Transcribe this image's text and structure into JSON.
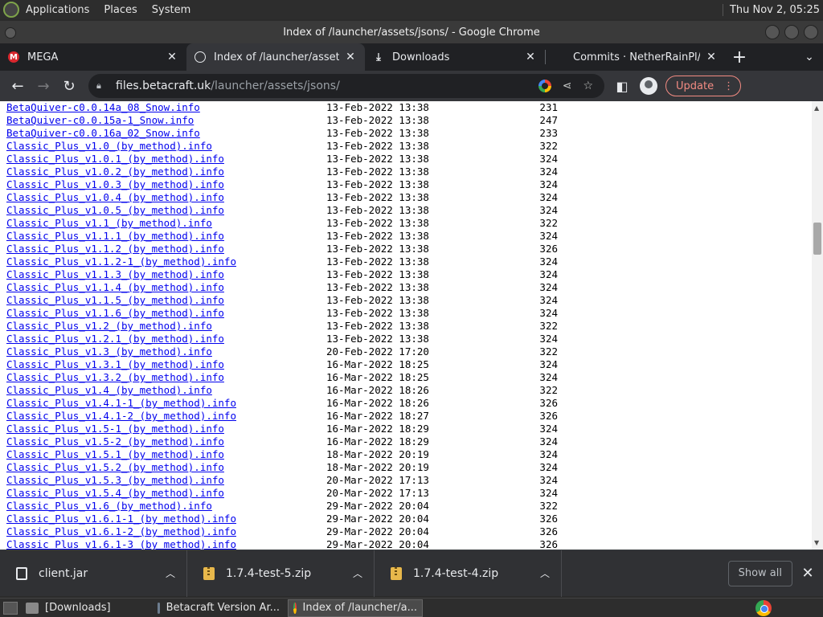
{
  "top_panel": {
    "menus": [
      "Applications",
      "Places",
      "System"
    ],
    "clock": "Thu Nov 2, 05:25"
  },
  "window": {
    "title": "Index of /launcher/assets/jsons/ - Google Chrome"
  },
  "tabs": [
    {
      "title": "MEGA",
      "favicon": "mega-icon",
      "active": false
    },
    {
      "title": "Index of /launcher/assets/jsons/",
      "favicon": "globe-icon",
      "active": true
    },
    {
      "title": "Downloads",
      "favicon": "download-icon",
      "active": false
    },
    {
      "title": "Commits · NetherRainPl/co",
      "favicon": "github-icon",
      "active": false
    }
  ],
  "toolbar": {
    "url_host": "files.betacraft.uk",
    "url_path": "/launcher/assets/jsons/",
    "update_label": "Update"
  },
  "listing": [
    {
      "name": "BetaQuiver-c0.0.14a_08_Snow.info",
      "date": "13-Feb-2022 13:38",
      "size": "231"
    },
    {
      "name": "BetaQuiver-c0.0.15a-1_Snow.info",
      "date": "13-Feb-2022 13:38",
      "size": "247"
    },
    {
      "name": "BetaQuiver-c0.0.16a_02_Snow.info",
      "date": "13-Feb-2022 13:38",
      "size": "233"
    },
    {
      "name": "Classic_Plus_v1.0_(by_method).info",
      "date": "13-Feb-2022 13:38",
      "size": "322"
    },
    {
      "name": "Classic_Plus_v1.0.1_(by_method).info",
      "date": "13-Feb-2022 13:38",
      "size": "324"
    },
    {
      "name": "Classic_Plus_v1.0.2_(by_method).info",
      "date": "13-Feb-2022 13:38",
      "size": "324"
    },
    {
      "name": "Classic_Plus_v1.0.3_(by_method).info",
      "date": "13-Feb-2022 13:38",
      "size": "324"
    },
    {
      "name": "Classic_Plus_v1.0.4_(by_method).info",
      "date": "13-Feb-2022 13:38",
      "size": "324"
    },
    {
      "name": "Classic_Plus_v1.0.5_(by_method).info",
      "date": "13-Feb-2022 13:38",
      "size": "324"
    },
    {
      "name": "Classic_Plus_v1.1_(by_method).info",
      "date": "13-Feb-2022 13:38",
      "size": "322"
    },
    {
      "name": "Classic_Plus_v1.1.1_(by_method).info",
      "date": "13-Feb-2022 13:38",
      "size": "324"
    },
    {
      "name": "Classic_Plus_v1.1.2_(by_method).info",
      "date": "13-Feb-2022 13:38",
      "size": "326"
    },
    {
      "name": "Classic_Plus_v1.1.2-1_(by_method).info",
      "date": "13-Feb-2022 13:38",
      "size": "324"
    },
    {
      "name": "Classic_Plus_v1.1.3_(by_method).info",
      "date": "13-Feb-2022 13:38",
      "size": "324"
    },
    {
      "name": "Classic_Plus_v1.1.4_(by_method).info",
      "date": "13-Feb-2022 13:38",
      "size": "324"
    },
    {
      "name": "Classic_Plus_v1.1.5_(by_method).info",
      "date": "13-Feb-2022 13:38",
      "size": "324"
    },
    {
      "name": "Classic_Plus_v1.1.6_(by_method).info",
      "date": "13-Feb-2022 13:38",
      "size": "324"
    },
    {
      "name": "Classic_Plus_v1.2_(by_method).info",
      "date": "13-Feb-2022 13:38",
      "size": "322"
    },
    {
      "name": "Classic_Plus_v1.2.1_(by_method).info",
      "date": "13-Feb-2022 13:38",
      "size": "324"
    },
    {
      "name": "Classic_Plus_v1.3_(by_method).info",
      "date": "20-Feb-2022 17:20",
      "size": "322"
    },
    {
      "name": "Classic_Plus_v1.3.1_(by_method).info",
      "date": "16-Mar-2022 18:25",
      "size": "324"
    },
    {
      "name": "Classic_Plus_v1.3.2_(by_method).info",
      "date": "16-Mar-2022 18:25",
      "size": "324"
    },
    {
      "name": "Classic_Plus_v1.4_(by_method).info",
      "date": "16-Mar-2022 18:26",
      "size": "322"
    },
    {
      "name": "Classic_Plus_v1.4.1-1_(by_method).info",
      "date": "16-Mar-2022 18:26",
      "size": "326"
    },
    {
      "name": "Classic_Plus_v1.4.1-2_(by_method).info",
      "date": "16-Mar-2022 18:27",
      "size": "326"
    },
    {
      "name": "Classic_Plus_v1.5-1_(by_method).info",
      "date": "16-Mar-2022 18:29",
      "size": "324"
    },
    {
      "name": "Classic_Plus_v1.5-2_(by_method).info",
      "date": "16-Mar-2022 18:29",
      "size": "324"
    },
    {
      "name": "Classic_Plus_v1.5.1_(by_method).info",
      "date": "18-Mar-2022 20:19",
      "size": "324"
    },
    {
      "name": "Classic_Plus_v1.5.2_(by_method).info",
      "date": "18-Mar-2022 20:19",
      "size": "324"
    },
    {
      "name": "Classic_Plus_v1.5.3_(by_method).info",
      "date": "20-Mar-2022 17:13",
      "size": "324"
    },
    {
      "name": "Classic_Plus_v1.5.4_(by_method).info",
      "date": "20-Mar-2022 17:13",
      "size": "324"
    },
    {
      "name": "Classic_Plus_v1.6_(by_method).info",
      "date": "29-Mar-2022 20:04",
      "size": "322"
    },
    {
      "name": "Classic_Plus_v1.6.1-1_(by_method).info",
      "date": "29-Mar-2022 20:04",
      "size": "326"
    },
    {
      "name": "Classic_Plus_v1.6.1-2_(by_method).info",
      "date": "29-Mar-2022 20:04",
      "size": "326"
    },
    {
      "name": "Classic_Plus_v1.6.1-3_(by_method).info",
      "date": "29-Mar-2022 20:04",
      "size": "326"
    }
  ],
  "downloads": [
    {
      "name": "client.jar",
      "icon": "file-icon"
    },
    {
      "name": "1.7.4-test-5.zip",
      "icon": "zip-icon"
    },
    {
      "name": "1.7.4-test-4.zip",
      "icon": "zip-icon"
    }
  ],
  "download_shelf": {
    "show_all_label": "Show all"
  },
  "taskbar": {
    "tasks": [
      {
        "label": "[Downloads]",
        "icon": "folder-icon",
        "active": false
      },
      {
        "label": "Betacraft Version Ar...",
        "icon": "terminal-icon",
        "active": false
      },
      {
        "label": "Index of /launcher/a...",
        "icon": "chrome-icon",
        "active": true
      }
    ]
  }
}
